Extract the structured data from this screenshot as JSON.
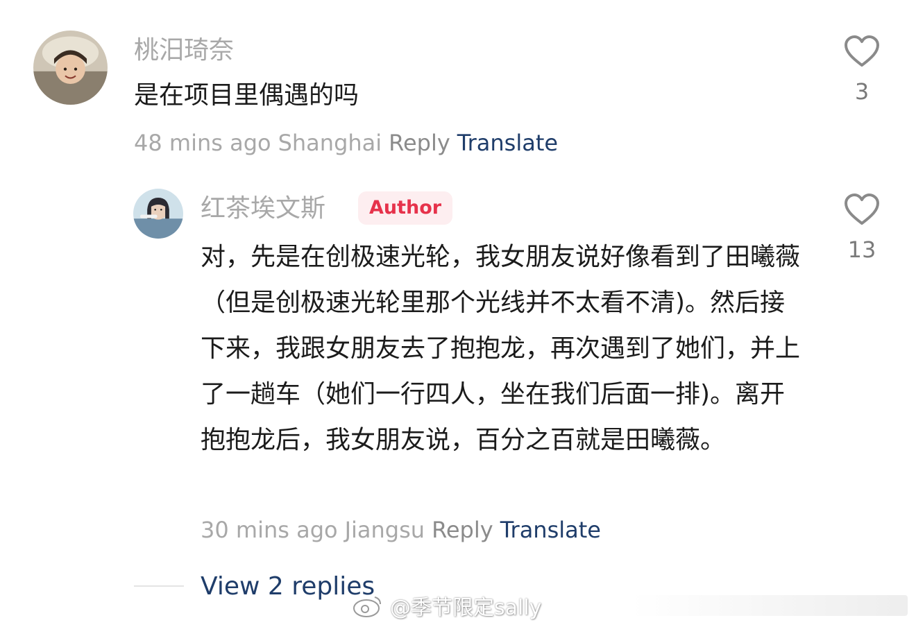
{
  "comments": [
    {
      "username": "桃汨琦奈",
      "text": "是在项目里偶遇的吗",
      "time": "48 mins ago",
      "location": "Shanghai",
      "reply_label": "Reply",
      "translate_label": "Translate",
      "like_count": "3",
      "avatar_icon": "avatar-photo"
    },
    {
      "username": "红茶埃文斯",
      "badge": "Author",
      "text": "对，先是在创极速光轮，我女朋友说好像看到了田曦薇（但是创极速光轮里那个光线并不太看不清)。然后接下来，我跟女朋友去了抱抱龙，再次遇到了她们，并上了一趟车（她们一行四人，坐在我们后面一排)。离开抱抱龙后，我女朋友说，百分之百就是田曦薇。",
      "time": "30 mins ago",
      "location": "Jiangsu",
      "reply_label": "Reply",
      "translate_label": "Translate",
      "like_count": "13",
      "avatar_icon": "avatar-photo"
    }
  ],
  "view_replies_label": "View 2 replies",
  "watermark": "@季节限定sally",
  "colors": {
    "username": "#a8a8a8",
    "text": "#1b1b1b",
    "translate": "#1f3d6a",
    "author_badge_bg": "#fdeef0",
    "author_badge_text": "#e6324b"
  },
  "icons": [
    "heart-icon",
    "weibo-logo-icon"
  ]
}
